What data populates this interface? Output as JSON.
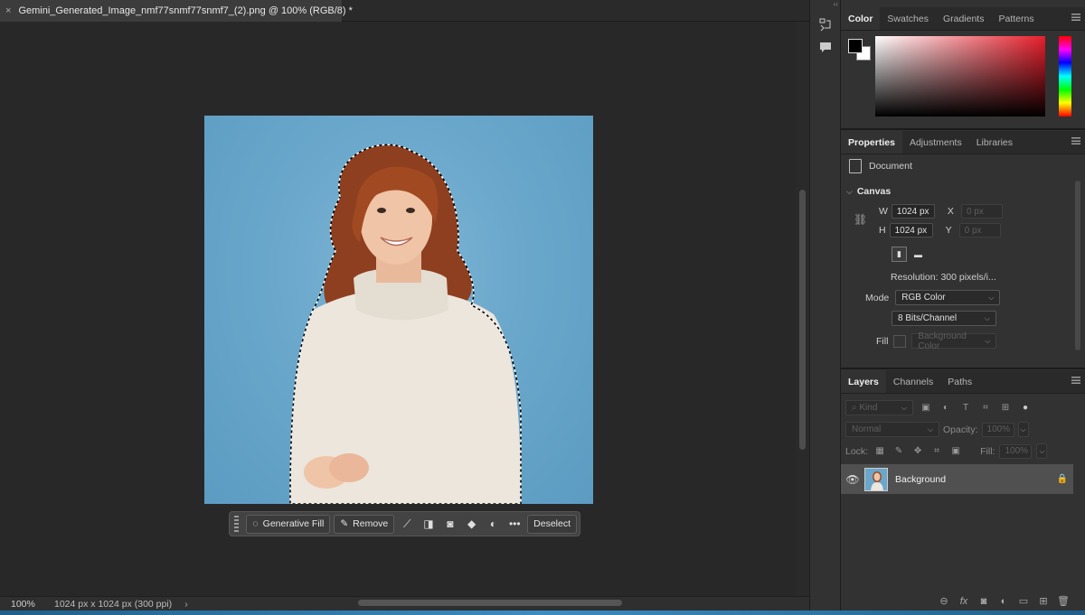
{
  "document": {
    "tab_title": "Gemini_Generated_Image_nmf77snmf77snmf7_(2).png @ 100% (RGB/8) *",
    "close_glyph": "×"
  },
  "taskbar": {
    "generative_fill": "Generative Fill",
    "remove": "Remove",
    "deselect": "Deselect",
    "more": "•••"
  },
  "status": {
    "zoom": "100%",
    "info": "1024 px x 1024 px (300 ppi)",
    "chevron": "›"
  },
  "color_panel": {
    "tabs": [
      "Color",
      "Swatches",
      "Gradients",
      "Patterns"
    ],
    "foreground": "#000000",
    "background": "#ffffff"
  },
  "properties_panel": {
    "tabs": [
      "Properties",
      "Adjustments",
      "Libraries"
    ],
    "section_document": "Document",
    "section_canvas": "Canvas",
    "w_label": "W",
    "w_value": "1024 px",
    "x_label": "X",
    "x_value": "0 px",
    "h_label": "H",
    "h_value": "1024 px",
    "y_label": "Y",
    "y_value": "0 px",
    "resolution": "Resolution: 300 pixels/i...",
    "mode_label": "Mode",
    "mode_value": "RGB Color",
    "bits_value": "8 Bits/Channel",
    "fill_label": "Fill",
    "fill_value": "Background Color"
  },
  "layers_panel": {
    "tabs": [
      "Layers",
      "Channels",
      "Paths"
    ],
    "kind_placeholder": "Kind",
    "blend_mode": "Normal",
    "opacity_label": "Opacity:",
    "opacity_value": "100%",
    "lock_label": "Lock:",
    "fill_label": "Fill:",
    "fill_value": "100%",
    "layer_name": "Background",
    "footer_icons": [
      "link-icon",
      "fx-icon",
      "mask-icon",
      "adjustment-icon",
      "folder-icon",
      "new-layer-icon",
      "trash-icon"
    ],
    "fx_label": "fx"
  },
  "colors": {
    "accent_blue": "#3b8cc0",
    "photo_background": "#6aa7cb"
  }
}
